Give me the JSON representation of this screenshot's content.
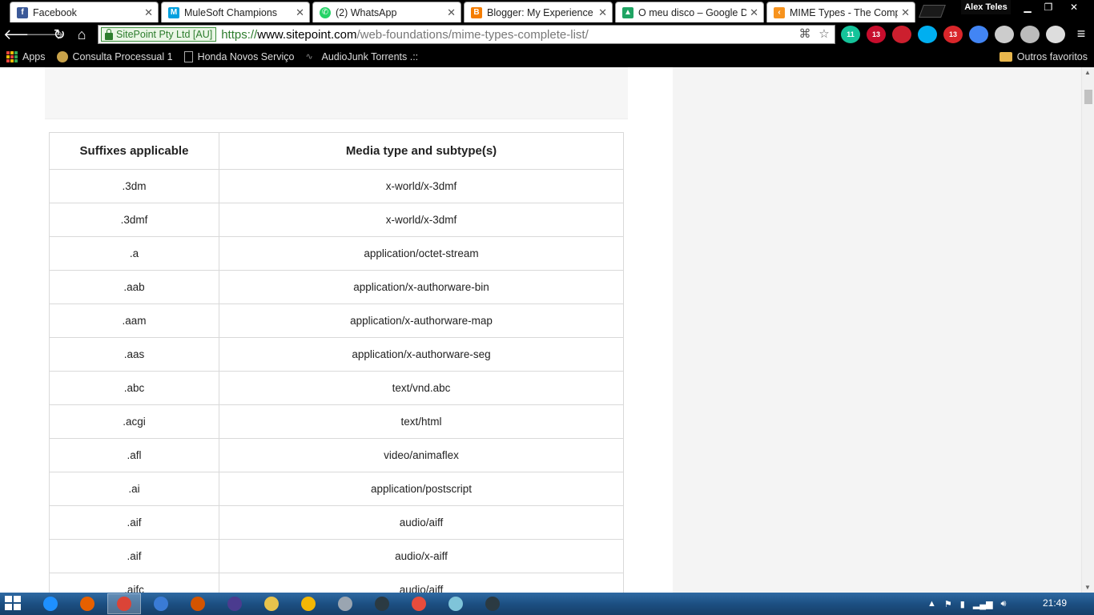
{
  "browser": {
    "tabs": [
      {
        "title": "Facebook",
        "icon": "facebook-icon",
        "color": "#3b5998"
      },
      {
        "title": "MuleSoft Champions",
        "icon": "mulesoft-icon",
        "color": "#00a0df"
      },
      {
        "title": "(2) WhatsApp",
        "icon": "whatsapp-icon",
        "color": "#25d366"
      },
      {
        "title": "Blogger: My Experience w",
        "icon": "blogger-icon",
        "color": "#f57d00"
      },
      {
        "title": "O meu disco – Google Dr",
        "icon": "google-drive-icon",
        "color": "#1fa463"
      },
      {
        "title": "MIME Types - The Compl",
        "icon": "sitepoint-icon",
        "color": "#f7931e"
      }
    ],
    "profile_name": "Alex Teles",
    "omnibox": {
      "ev_label": "SitePoint Pty Ltd [AU]",
      "scheme": "https://",
      "host": "www.sitepoint.com",
      "path": "/web-foundations/mime-types-complete-list/"
    },
    "extensions": [
      {
        "name": "grammarly-icon",
        "badge": "11",
        "color": "#15c39a"
      },
      {
        "name": "adblock-plus-icon",
        "badge": "13",
        "color": "#c70d2c"
      },
      {
        "name": "opera-red-icon",
        "badge": "",
        "color": "#cc1f2e"
      },
      {
        "name": "skype-icon",
        "badge": "",
        "color": "#00aff0"
      },
      {
        "name": "pdf-icon",
        "badge": "13",
        "color": "#d9262a"
      },
      {
        "name": "google-translate-icon",
        "badge": "",
        "color": "#4285f4"
      },
      {
        "name": "airplane-icon",
        "badge": "",
        "color": "#cccccc"
      },
      {
        "name": "circle-icon",
        "badge": "",
        "color": "#bbbbbb"
      },
      {
        "name": "x-icon",
        "badge": "",
        "color": "#dddddd"
      }
    ],
    "bookmarks": [
      {
        "label": "Apps",
        "icon": "apps-icon"
      },
      {
        "label": "Consulta Processual 1",
        "icon": "seal-icon"
      },
      {
        "label": "Honda Novos Serviço",
        "icon": "page-icon"
      },
      {
        "label": "AudioJunk Torrents .::",
        "icon": "waveform-icon"
      }
    ],
    "other_bookmarks": "Outros favoritos"
  },
  "table": {
    "headers": [
      "Suffixes applicable",
      "Media type and subtype(s)"
    ],
    "rows": [
      [
        ".3dm",
        "x-world/x-3dmf"
      ],
      [
        ".3dmf",
        "x-world/x-3dmf"
      ],
      [
        ".a",
        "application/octet-stream"
      ],
      [
        ".aab",
        "application/x-authorware-bin"
      ],
      [
        ".aam",
        "application/x-authorware-map"
      ],
      [
        ".aas",
        "application/x-authorware-seg"
      ],
      [
        ".abc",
        "text/vnd.abc"
      ],
      [
        ".acgi",
        "text/html"
      ],
      [
        ".afl",
        "video/animaflex"
      ],
      [
        ".ai",
        "application/postscript"
      ],
      [
        ".aif",
        "audio/aiff"
      ],
      [
        ".aif",
        "audio/x-aiff"
      ],
      [
        ".aifc",
        "audio/aiff"
      ]
    ]
  },
  "taskbar": {
    "apps": [
      {
        "name": "internet-explorer-icon",
        "color": "#1e90ff",
        "active": false
      },
      {
        "name": "firefox-icon",
        "color": "#e66000",
        "active": false
      },
      {
        "name": "chrome-icon",
        "color": "#db4437",
        "active": true
      },
      {
        "name": "app-blue-icon",
        "color": "#3a7bd5",
        "active": false
      },
      {
        "name": "app-orange-icon",
        "color": "#d35400",
        "active": false
      },
      {
        "name": "eclipse-icon",
        "color": "#4b3b8f",
        "active": false
      },
      {
        "name": "file-explorer-icon",
        "color": "#e8c34c",
        "active": false
      },
      {
        "name": "app-yellow-icon",
        "color": "#f2b705",
        "active": false
      },
      {
        "name": "app-gray-icon",
        "color": "#9aa5b1",
        "active": false
      },
      {
        "name": "sublime-icon",
        "color": "#2b3a42",
        "active": false
      },
      {
        "name": "app-red-icon",
        "color": "#e74c3c",
        "active": false
      },
      {
        "name": "notepad-icon",
        "color": "#7fc4d9",
        "active": false
      },
      {
        "name": "sitepoint-app-icon",
        "color": "#2b3a42",
        "active": false
      }
    ],
    "clock": "21:49"
  }
}
